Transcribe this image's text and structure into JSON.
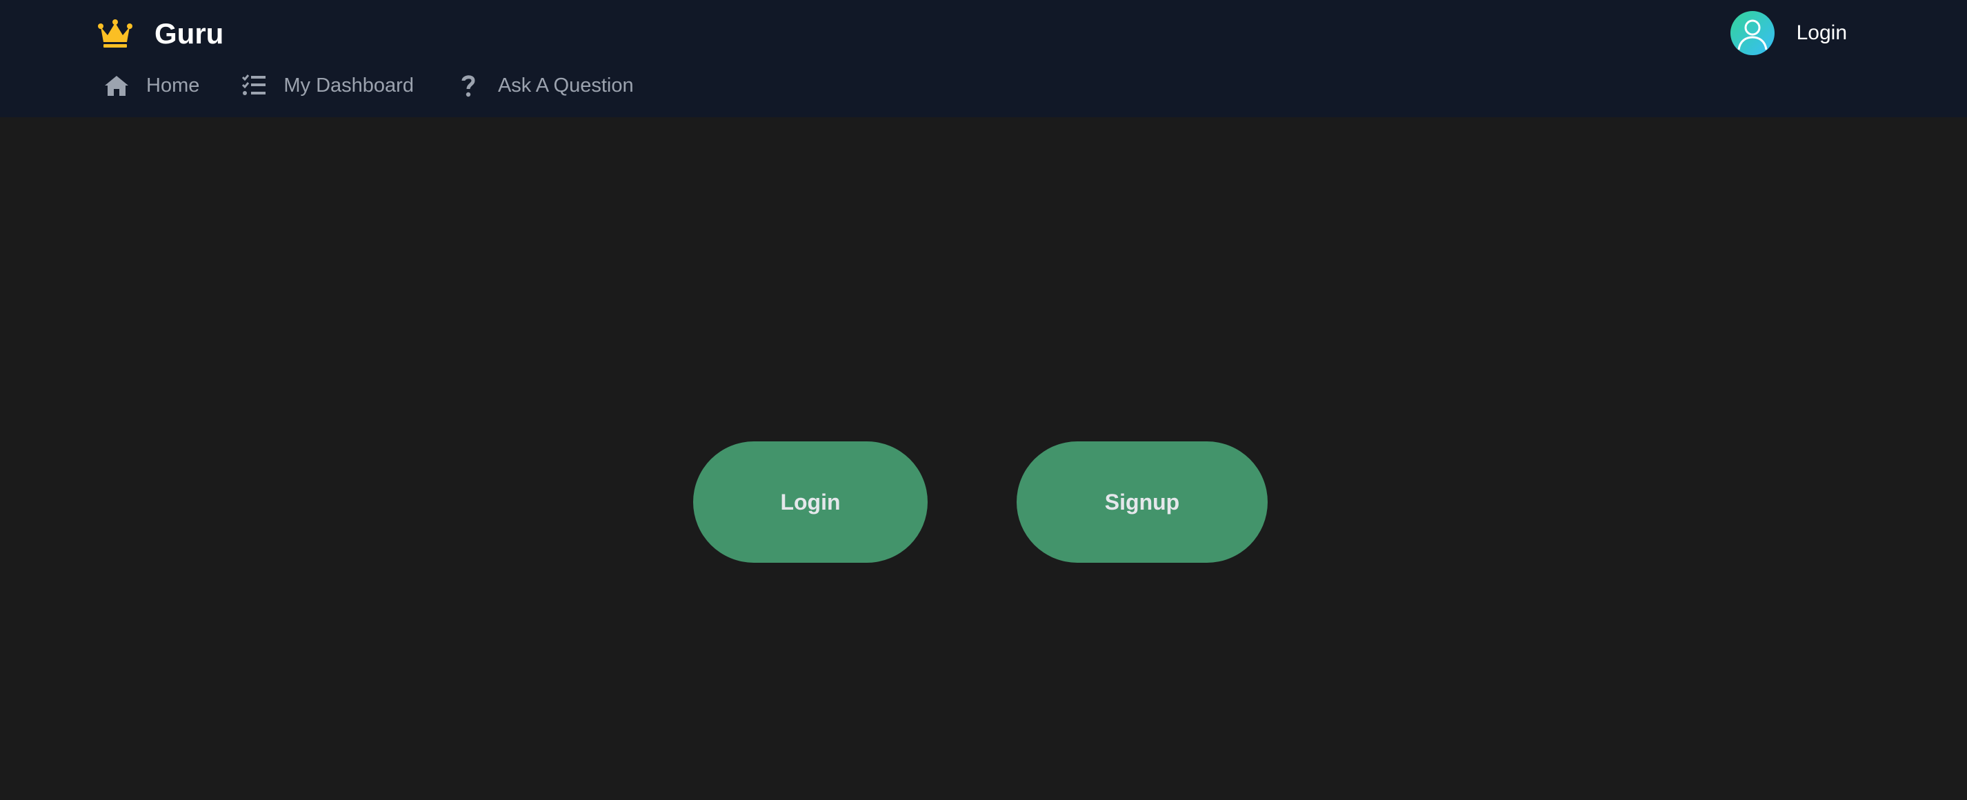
{
  "header": {
    "brand_name": "Guru",
    "brand_icon": "crown-icon",
    "user": {
      "avatar_icon": "user-avatar-icon",
      "login_label": "Login"
    },
    "nav": [
      {
        "label": "Home",
        "icon": "home-icon"
      },
      {
        "label": "My Dashboard",
        "icon": "checklist-icon"
      },
      {
        "label": "Ask A Question",
        "icon": "question-icon"
      }
    ]
  },
  "main": {
    "login_button": "Login",
    "signup_button": "Signup"
  },
  "colors": {
    "header_bg": "#111827",
    "page_bg": "#1b1b1b",
    "button_bg": "#43946b",
    "crown": "#fbbf24",
    "nav_text": "#9ca3af"
  }
}
